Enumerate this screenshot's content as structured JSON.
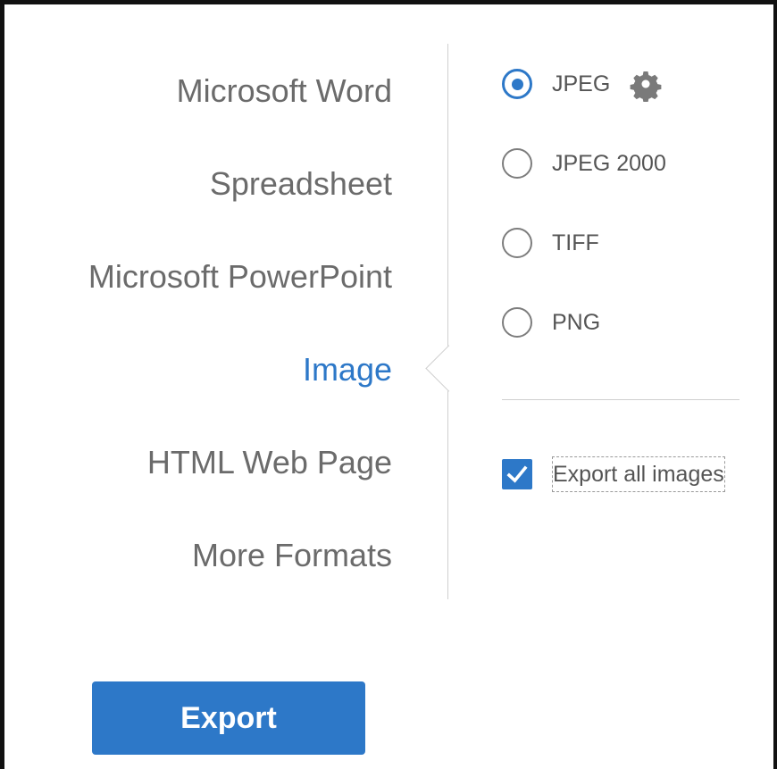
{
  "formats": [
    {
      "id": "word",
      "label": "Microsoft Word",
      "active": false
    },
    {
      "id": "spreadsheet",
      "label": "Spreadsheet",
      "active": false
    },
    {
      "id": "powerpoint",
      "label": "Microsoft PowerPoint",
      "active": false
    },
    {
      "id": "image",
      "label": "Image",
      "active": true
    },
    {
      "id": "html",
      "label": "HTML Web Page",
      "active": false
    },
    {
      "id": "more",
      "label": "More Formats",
      "active": false
    }
  ],
  "image_options": [
    {
      "id": "jpeg",
      "label": "JPEG",
      "selected": true,
      "has_settings": true
    },
    {
      "id": "jpeg2000",
      "label": "JPEG 2000",
      "selected": false,
      "has_settings": false
    },
    {
      "id": "tiff",
      "label": "TIFF",
      "selected": false,
      "has_settings": false
    },
    {
      "id": "png",
      "label": "PNG",
      "selected": false,
      "has_settings": false
    }
  ],
  "export_all_images": {
    "label": "Export all images",
    "checked": true
  },
  "export_button": {
    "label": "Export"
  },
  "icons": {
    "settings": "gear-icon",
    "check": "checkmark-icon"
  },
  "colors": {
    "accent": "#2d78c8",
    "text": "#6b6b6b",
    "divider": "#cfcfcf"
  }
}
